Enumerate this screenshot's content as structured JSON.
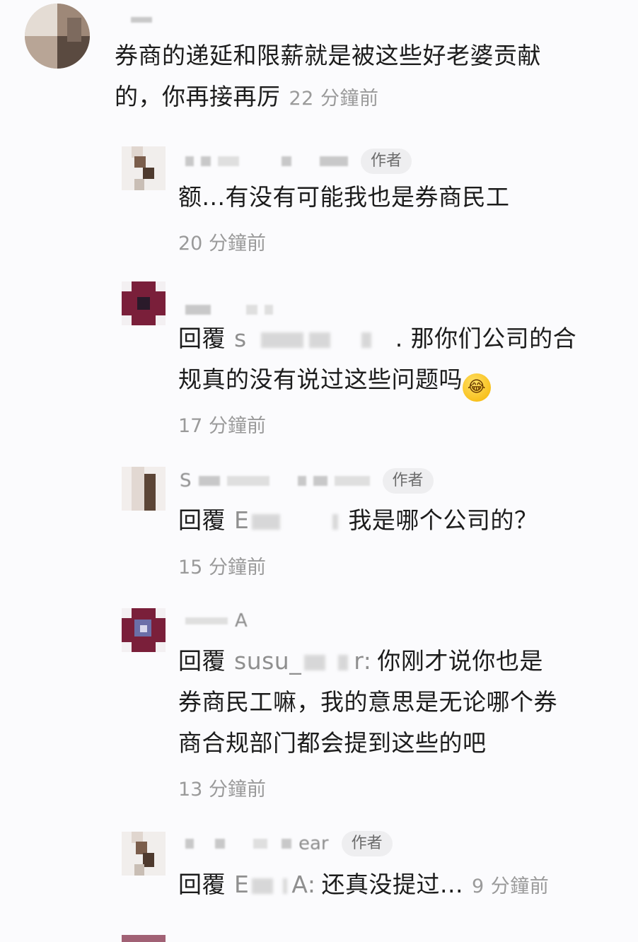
{
  "comments": [
    {
      "text_line1": "券商的递延和限薪就是被这些好老婆贡献",
      "text_line2": "的，你再接再厉",
      "time": "22 分鐘前"
    },
    {
      "name_fragment": "",
      "author_tag": "作者",
      "text": "额...有没有可能我也是券商民工",
      "time": "20 分鐘前"
    },
    {
      "reply_label": "回覆",
      "target_fragment": "s",
      "text_line1_suffix": ". 那你们公司的合",
      "text_line2": "规真的没有说过这些问题吗",
      "emoji": "rolling-on-floor-laughing-emoji",
      "time": "17 分鐘前"
    },
    {
      "name_fragment": "S",
      "author_tag": "作者",
      "reply_label": "回覆",
      "target_fragment": "E",
      "text": "我是哪个公司的？",
      "time": "15 分鐘前"
    },
    {
      "name_fragment": "A",
      "reply_label": "回覆",
      "target_fragment": "susu_",
      "target_suffix": "r:",
      "text_line1": "你刚才说你也是",
      "text_line2": "券商民工嘛，我的意思是无论哪个券",
      "text_line3": "商合规部门都会提到这些的吧",
      "time": "13 分鐘前"
    },
    {
      "name_fragment": "ear",
      "author_tag": "作者",
      "reply_label": "回覆",
      "target_fragment": "E",
      "target_suffix": "A:",
      "text": "还真没提过...",
      "time": "9 分鐘前"
    }
  ],
  "colors": {
    "background": "#fbfbfd",
    "text": "#1c1c1c",
    "muted": "#9a9a9a",
    "author_tag_bg": "#eeeef0",
    "avatar_maroon": "#7a1f3a"
  }
}
